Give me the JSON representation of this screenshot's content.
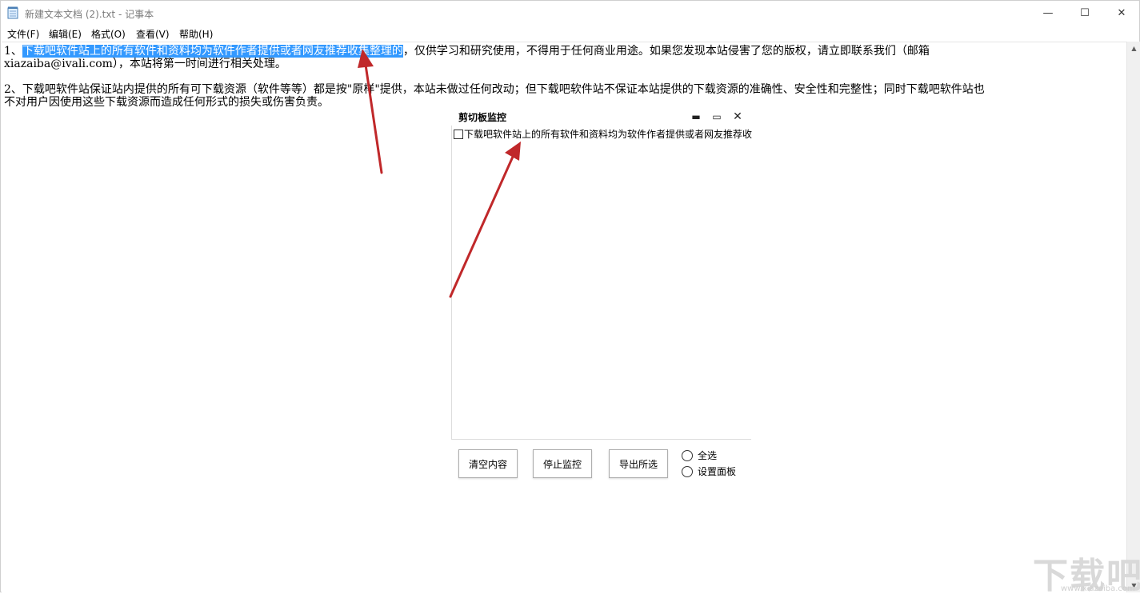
{
  "window": {
    "title": "新建文本文档 (2).txt - 记事本",
    "controls": {
      "minimize": "—",
      "maximize": "☐",
      "close": "✕"
    }
  },
  "menu": [
    {
      "label": "文件(F)"
    },
    {
      "label": "编辑(E)"
    },
    {
      "label": "格式(O)"
    },
    {
      "label": "查看(V)"
    },
    {
      "label": "帮助(H)"
    }
  ],
  "editor": {
    "line1_prefix": "1、",
    "line1_selected": "下载吧软件站上的所有软件和资料均为软件作者提供或者网友推荐收集整理的",
    "line1_rest": "，仅供学习和研究使用，不得用于任何商业用途。如果您发现本站侵害了您的版权，请立即联系我们（邮箱",
    "line2": "xiazaiba@ivali.com），本站将第一时间进行相关处理。",
    "line3": "2、下载吧软件站保证站内提供的所有可下载资源（软件等等）都是按\"原样\"提供，本站未做过任何改动；但下载吧软件站不保证本站提供的下载资源的准确性、安全性和完整性；同时下载吧软件站也",
    "line4": "不对用户因使用这些下载资源而造成任何形式的损失或伤害负责。"
  },
  "panel": {
    "title": "剪切板监控",
    "controls": {
      "minimize": "▬",
      "maximize": "▭",
      "close": "✕"
    },
    "items": [
      {
        "text": "下载吧软件站上的所有软件和资料均为软件作者提供或者网友推荐收",
        "checked": false
      }
    ],
    "buttons": {
      "clear": "清空内容",
      "stop": "停止监控",
      "export": "导出所选"
    },
    "options": {
      "select_all": "全选",
      "settings": "设置面板"
    }
  },
  "watermark": {
    "logo": "下载吧",
    "url": "www.xiazaiba.com"
  },
  "colors": {
    "selection": "#3399ff",
    "arrow": "#c0282a"
  }
}
